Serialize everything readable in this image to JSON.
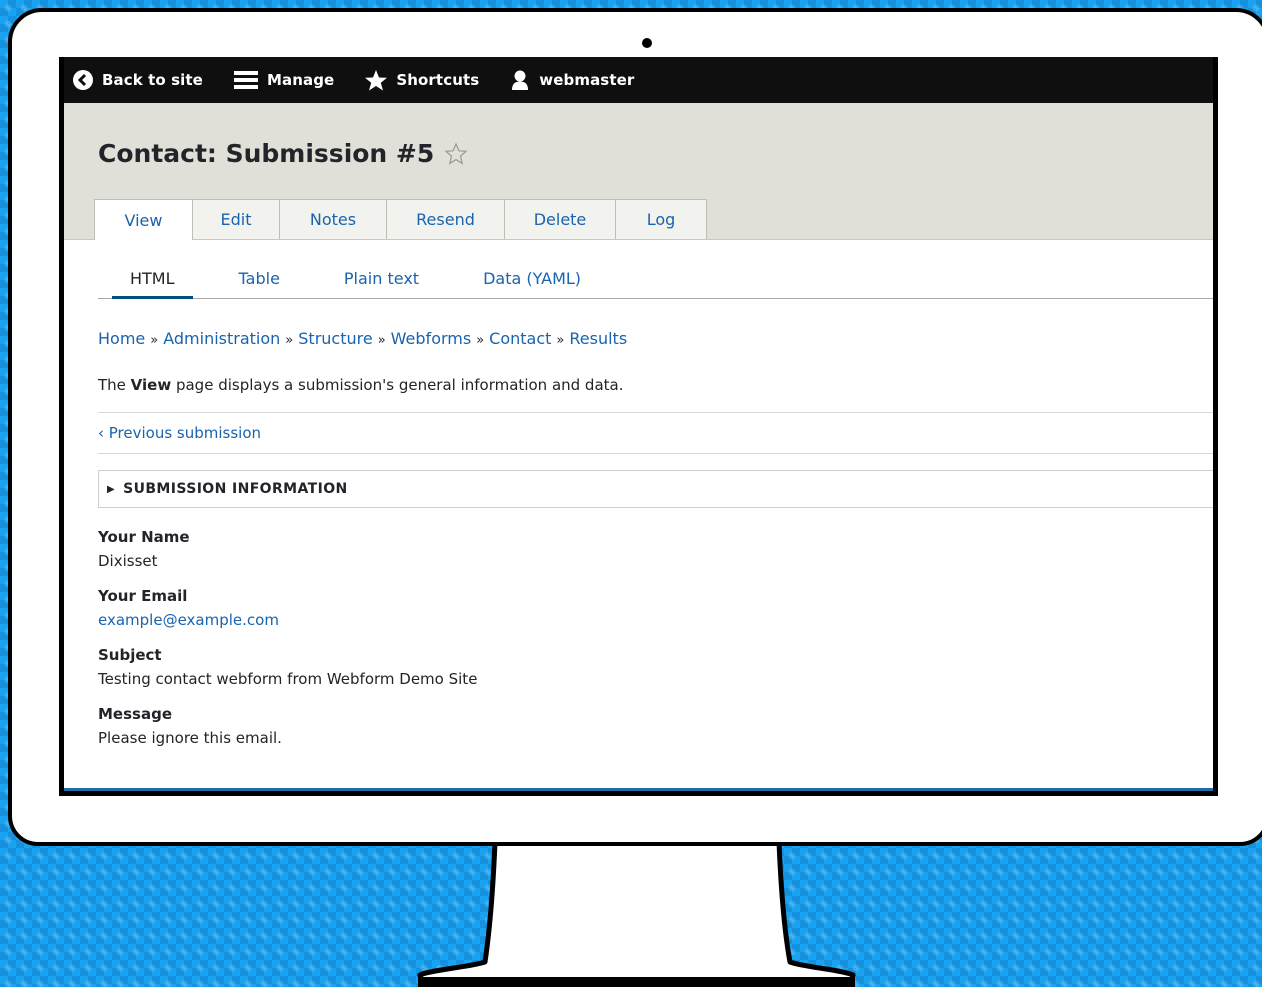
{
  "toolbar": {
    "back_label": "Back to site",
    "manage_label": "Manage",
    "shortcuts_label": "Shortcuts",
    "user_label": "webmaster"
  },
  "page": {
    "title": "Contact: Submission #5"
  },
  "tabs": [
    {
      "label": "View",
      "active": true
    },
    {
      "label": "Edit"
    },
    {
      "label": "Notes"
    },
    {
      "label": "Resend"
    },
    {
      "label": "Delete"
    },
    {
      "label": "Log"
    }
  ],
  "subtabs": [
    {
      "label": "HTML",
      "active": true
    },
    {
      "label": "Table"
    },
    {
      "label": "Plain text"
    },
    {
      "label": "Data (YAML)"
    }
  ],
  "breadcrumb": [
    "Home",
    "Administration",
    "Structure",
    "Webforms",
    "Contact",
    "Results"
  ],
  "breadcrumb_sep": "»",
  "help": {
    "prefix": "The ",
    "strong": "View",
    "suffix": " page displays a submission's general information and data."
  },
  "prev_link": "‹ Previous submission",
  "details_summary": "SUBMISSION INFORMATION",
  "fields": [
    {
      "label": "Your Name",
      "value": "Dixisset"
    },
    {
      "label": "Your Email",
      "value": "example@example.com"
    },
    {
      "label": "Subject",
      "value": "Testing contact webform from Webform Demo Site"
    },
    {
      "label": "Message",
      "value": "Please ignore this email."
    }
  ]
}
